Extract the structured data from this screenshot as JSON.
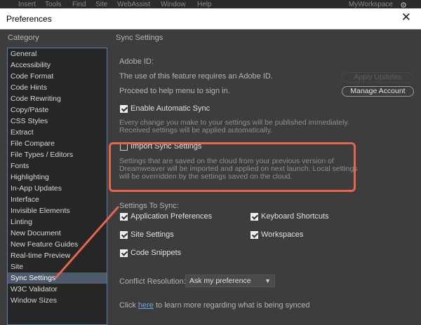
{
  "background_menu": {
    "items": [
      "Insert",
      "Tools",
      "Find",
      "Site",
      "WebAssist",
      "Window",
      "Help"
    ],
    "workspace": "MyWorkspace"
  },
  "dialog": {
    "title": "Preferences",
    "close_glyph": "✕"
  },
  "category": {
    "label": "Category",
    "items": [
      "General",
      "Accessibility",
      "Code Format",
      "Code Hints",
      "Code Rewriting",
      "Copy/Paste",
      "CSS Styles",
      "Extract",
      "File Compare",
      "File Types / Editors",
      "Fonts",
      "Highlighting",
      "In-App Updates",
      "Interface",
      "Invisible Elements",
      "Linting",
      "New Document",
      "New Feature Guides",
      "Real-time Preview",
      "Site",
      "Sync Settings",
      "W3C Validator",
      "Window Sizes"
    ],
    "selected": "Sync Settings"
  },
  "sync": {
    "title": "Sync Settings",
    "adobe_id_label": "Adobe ID:",
    "requires_text": "The use of this feature requires an Adobe ID.",
    "proceed_text": "Proceed to help menu to sign in.",
    "apply_updates_label": "Apply Updates",
    "manage_account_label": "Manage Account",
    "enable_auto_sync": {
      "label": "Enable Automatic Sync",
      "checked": true
    },
    "auto_sync_desc_1": "Every change you make to your settings will be published immediately.",
    "auto_sync_desc_2": "Received settings will be applied automatically.",
    "import_sync": {
      "label": "Import Sync Settings",
      "checked": false
    },
    "import_desc_1": "Settings that are saved on the cloud from your previous version of",
    "import_desc_2": "Dreamweaver will be imported and applied on next launch. Local settings",
    "import_desc_3": "will be overridden by the settings saved on the cloud.",
    "settings_to_sync_label": "Settings To Sync:",
    "options": {
      "app_prefs": {
        "label": "Application Preferences",
        "checked": true
      },
      "keyboard": {
        "label": "Keyboard Shortcuts",
        "checked": true
      },
      "site_settings": {
        "label": "Site Settings",
        "checked": true
      },
      "workspaces": {
        "label": "Workspaces",
        "checked": true
      },
      "code_snippets": {
        "label": "Code Snippets",
        "checked": true
      }
    },
    "conflict_label": "Conflict Resolution:",
    "conflict_value": "Ask my preference",
    "more_prefix": "Click",
    "more_link": "here",
    "more_suffix": "to learn more regarding what is being synced"
  },
  "colors": {
    "annotation": "#e8654a",
    "selection": "#4d5a6a",
    "link": "#6fa8e0"
  }
}
